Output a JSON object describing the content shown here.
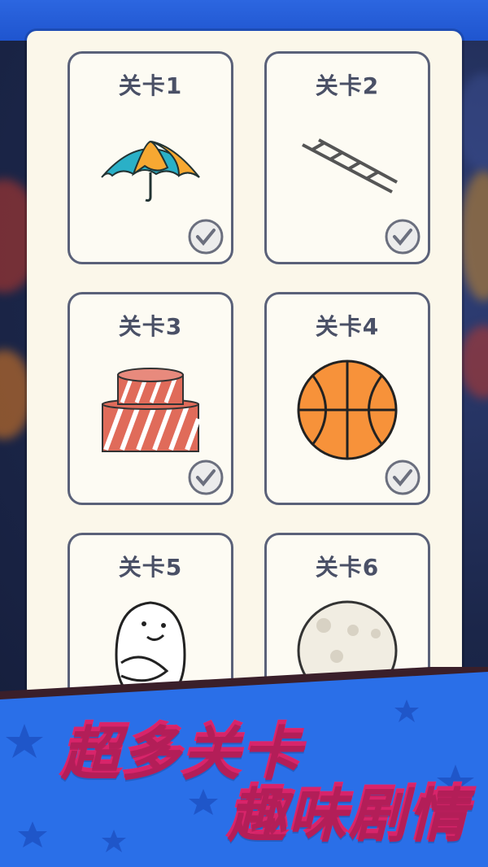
{
  "levels": [
    {
      "title": "关卡1",
      "icon": "umbrella-icon",
      "completed": true
    },
    {
      "title": "关卡2",
      "icon": "ladder-icon",
      "completed": true
    },
    {
      "title": "关卡3",
      "icon": "cake-icon",
      "completed": true
    },
    {
      "title": "关卡4",
      "icon": "basketball-icon",
      "completed": true
    },
    {
      "title": "关卡5",
      "icon": "egg-face-icon",
      "completed": false
    },
    {
      "title": "关卡6",
      "icon": "moon-icon",
      "completed": false
    }
  ],
  "promo": {
    "line1": "超多关卡",
    "line2": "趣味剧情"
  },
  "colors": {
    "panel_bg": "#fbf7ea",
    "card_border": "#5a6179",
    "promo_blue": "#2a6fe8",
    "promo_pink": "#ff4d7f",
    "check_gray": "#6b6f7e"
  }
}
